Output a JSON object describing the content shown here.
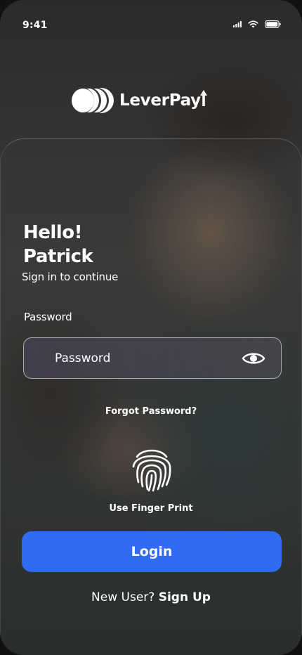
{
  "status_bar": {
    "time": "9:41",
    "icons": [
      "cellular-signal-icon",
      "wifi-icon",
      "battery-icon"
    ]
  },
  "brand": {
    "name": "LeverPay",
    "logo_icon": "leverpay-coins-icon"
  },
  "greeting": {
    "line1": "Hello!",
    "line2": "Patrick",
    "subtitle": "Sign in to continue"
  },
  "password": {
    "label": "Password",
    "placeholder": "Password",
    "value": "",
    "toggle_icon": "eye-icon"
  },
  "forgot_password": "Forgot Password?",
  "fingerprint": {
    "icon": "fingerprint-icon",
    "label": "Use Finger Print"
  },
  "login_button": "Login",
  "signup": {
    "prompt": "New User?",
    "link": "Sign Up"
  },
  "colors": {
    "primary": "#2F6CF0",
    "text": "#FFFFFF"
  }
}
